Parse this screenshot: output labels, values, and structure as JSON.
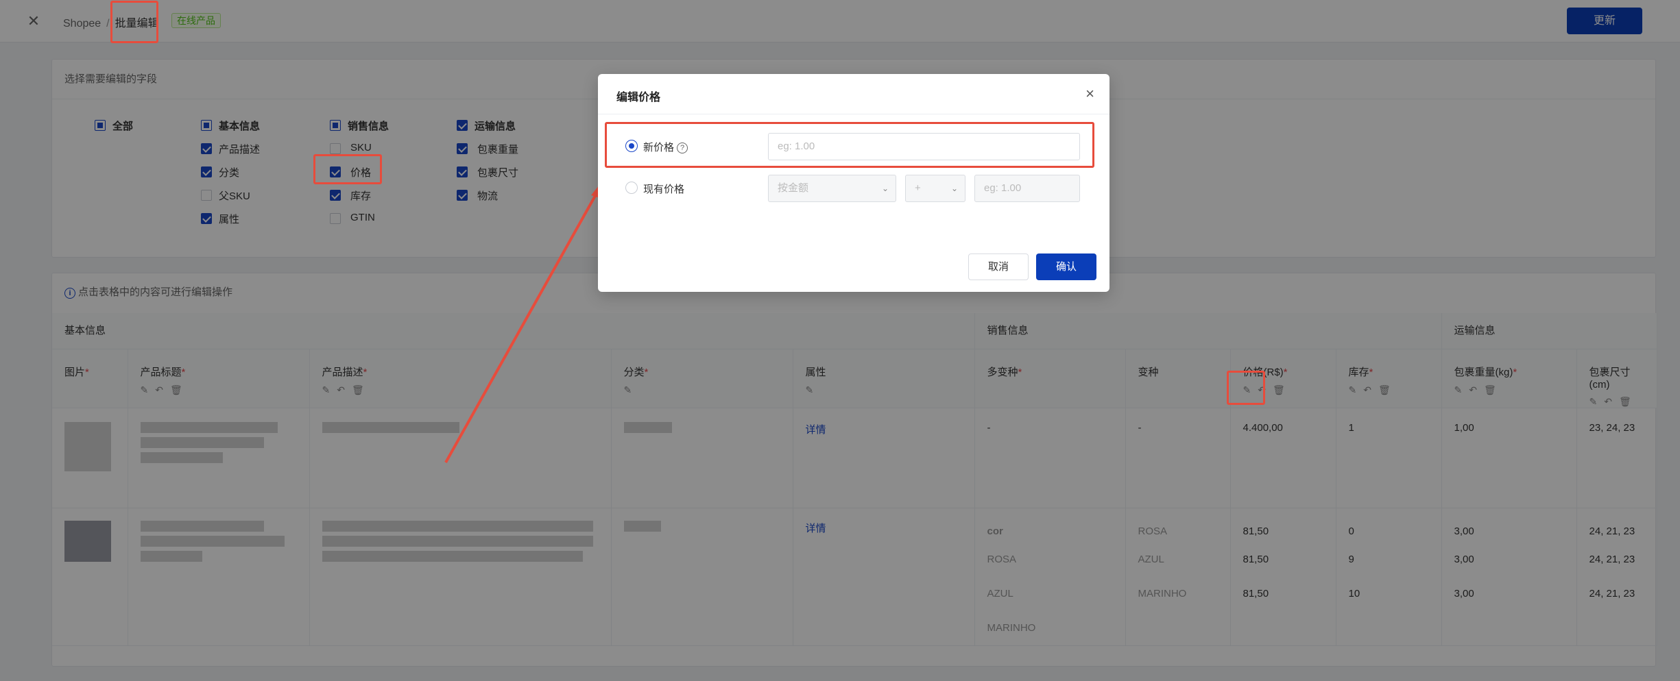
{
  "topbar": {
    "crumb_root": "Shopee",
    "crumb_sep": "/",
    "crumb_current": "批量编辑",
    "status_tag": "在线产品",
    "update_button": "更新"
  },
  "fields": {
    "title": "选择需要编辑的字段",
    "all": "全部",
    "basic": {
      "title": "基本信息",
      "items": [
        "产品描述",
        "分类",
        "父SKU",
        "属性"
      ]
    },
    "sales": {
      "title": "销售信息",
      "items": [
        "SKU",
        "价格",
        "库存",
        "GTIN"
      ]
    },
    "shipping": {
      "title": "运输信息",
      "items": [
        "包裹重量",
        "包裹尺寸",
        "物流"
      ]
    }
  },
  "table": {
    "hint": "点击表格中的内容可进行编辑操作",
    "groups": [
      "基本信息",
      "销售信息",
      "运输信息"
    ],
    "columns": [
      "图片",
      "产品标题",
      "产品描述",
      "分类",
      "属性",
      "多变种",
      "变种",
      "价格(R$)",
      "库存",
      "包裹重量(kg)",
      "包裹尺寸(cm)"
    ],
    "row1": {
      "attr": "详情",
      "multi": "-",
      "variant": "-",
      "price": "4.400,00",
      "stock": "1",
      "weight": "1,00",
      "size": "23, 24, 23"
    },
    "row2": {
      "attr": "详情",
      "multi": [
        "cor",
        "ROSA",
        "AZUL",
        "MARINHO"
      ],
      "variant": [
        "ROSA",
        "AZUL",
        "MARINHO"
      ],
      "price": [
        "81,50",
        "81,50",
        "81,50"
      ],
      "stock": [
        "0",
        "9",
        "10"
      ],
      "weight": [
        "3,00",
        "3,00",
        "3,00"
      ],
      "size": [
        "24, 21, 23",
        "24, 21, 23",
        "24, 21, 23"
      ]
    }
  },
  "modal": {
    "title": "编辑价格",
    "close": "×",
    "opt_new": "新价格",
    "opt_existing": "现有价格",
    "new_placeholder": "eg: 1.00",
    "mode_select": "按金额",
    "op_select": "+",
    "amount_placeholder": "eg: 1.00",
    "cancel": "取消",
    "confirm": "确认"
  },
  "colors": {
    "primary": "#0b3eb8",
    "highlight": "#e74c3c",
    "required": "#e5484d"
  }
}
